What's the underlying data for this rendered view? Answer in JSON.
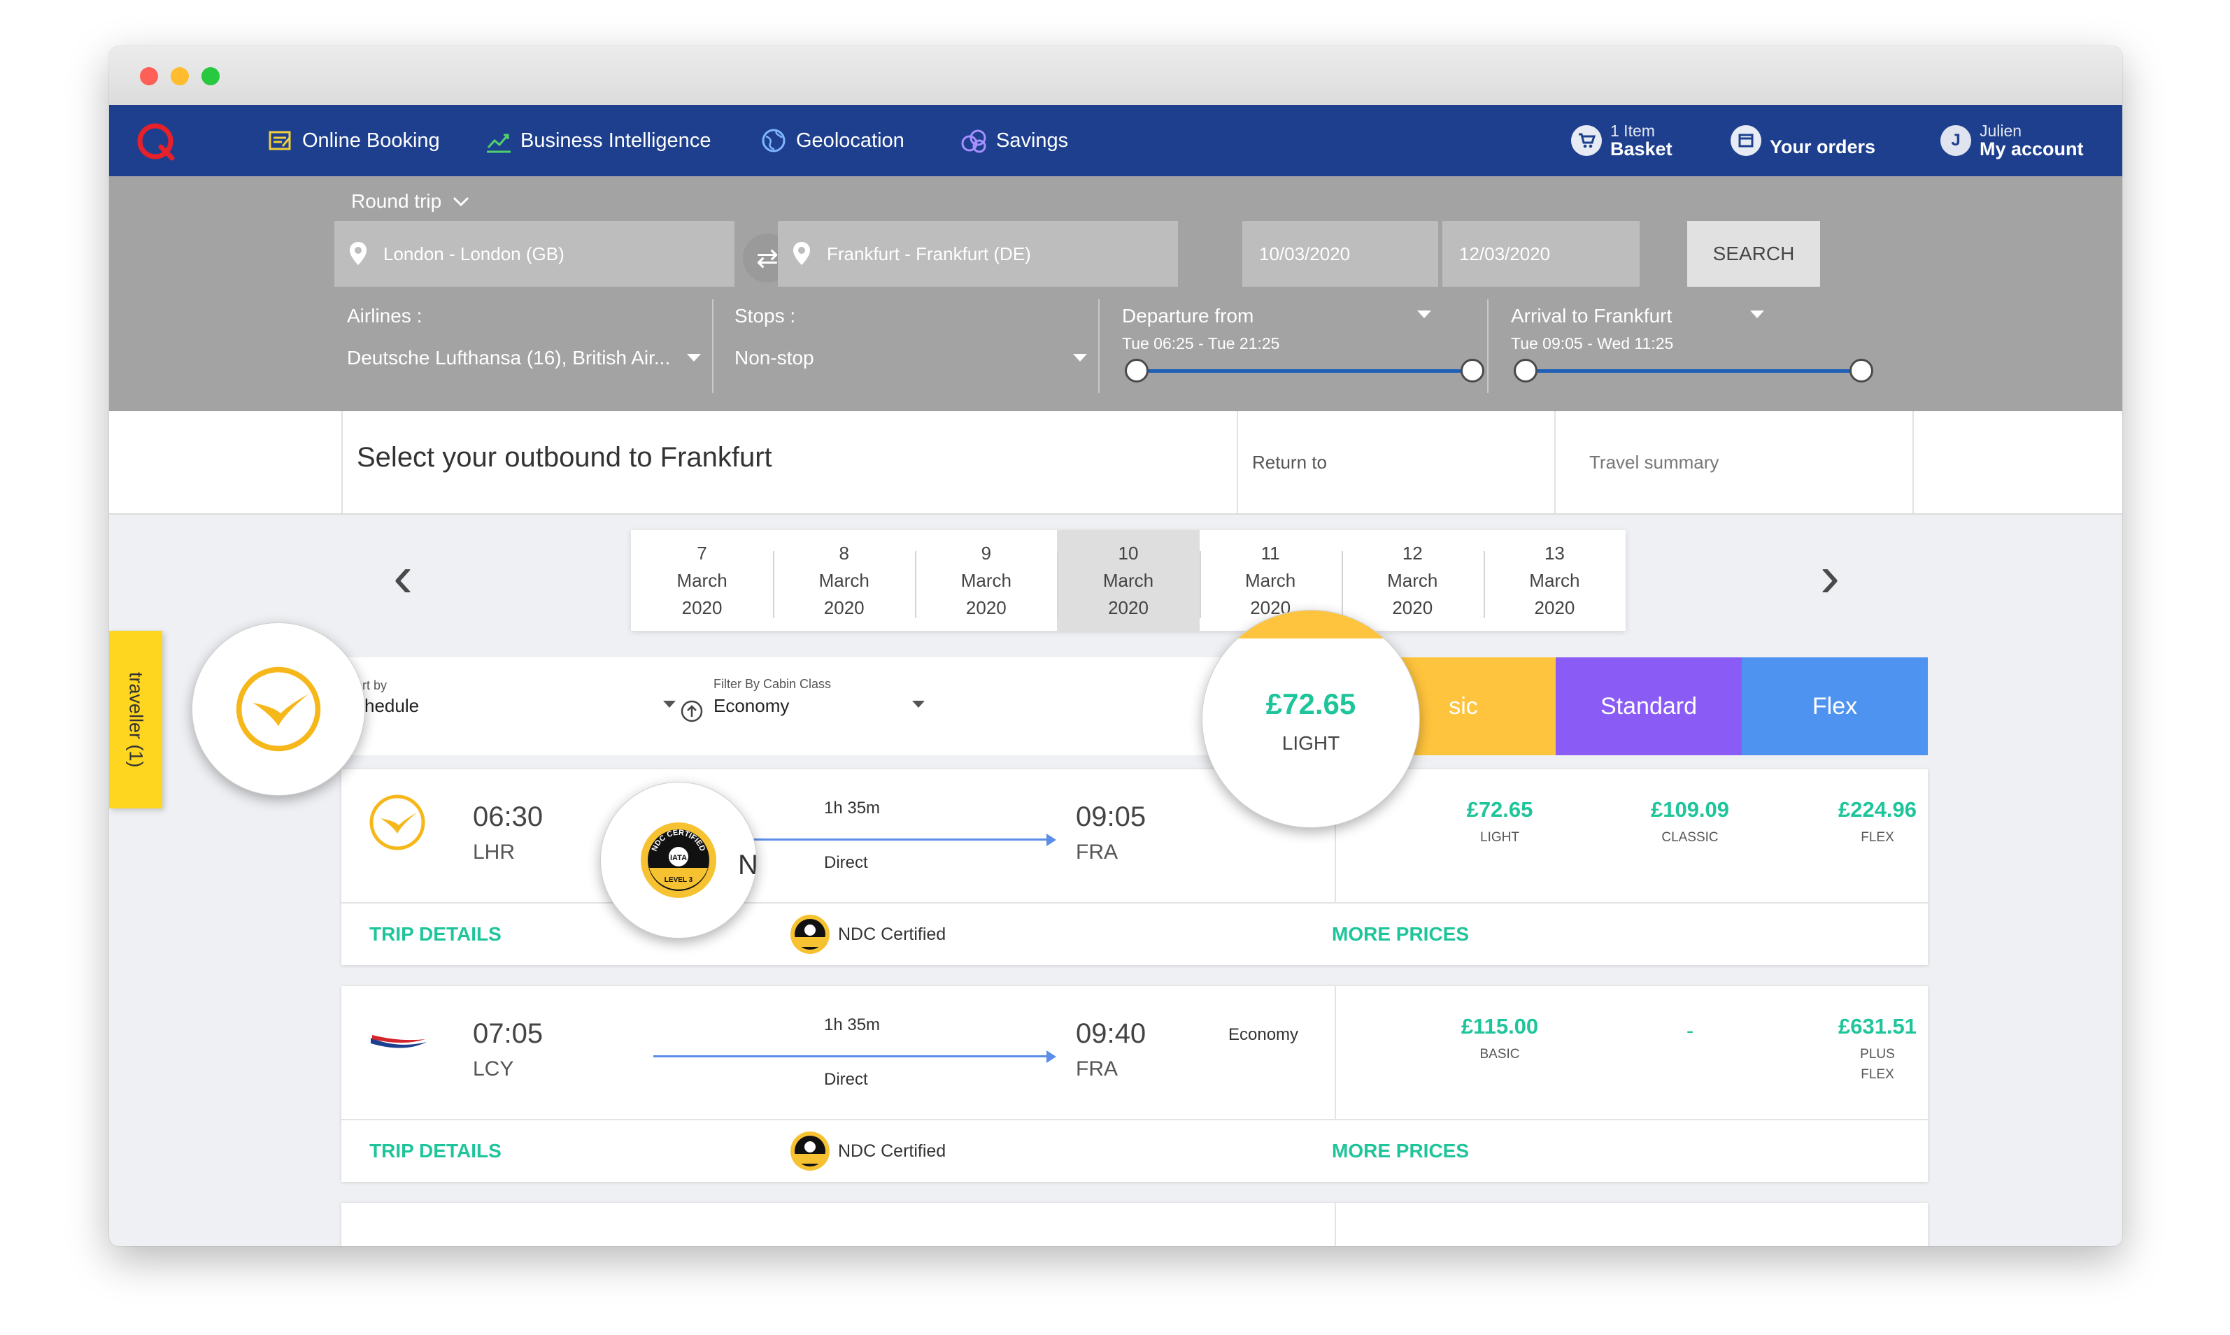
{
  "nav": {
    "items": [
      {
        "label": "Online Booking"
      },
      {
        "label": "Business Intelligence"
      },
      {
        "label": "Geolocation"
      },
      {
        "label": "Savings"
      }
    ],
    "basket": {
      "count": "1 Item",
      "label": "Basket"
    },
    "orders": {
      "label": "Your orders"
    },
    "account": {
      "user": "Julien",
      "label": "My account",
      "initial": "J"
    }
  },
  "search": {
    "trip_type": "Round trip",
    "origin": "London - London (GB)",
    "destination": "Frankfurt - Frankfurt (DE)",
    "depart_date": "10/03/2020",
    "return_date": "12/03/2020",
    "search_button": "SEARCH",
    "airlines_label": "Airlines :",
    "airlines_value": "Deutsche Lufthansa (16), British Air...",
    "stops_label": "Stops :",
    "stops_value": "Non-stop",
    "departure_label": "Departure from",
    "departure_range": "Tue 06:25 - Tue 21:25",
    "arrival_label": "Arrival to Frankfurt",
    "arrival_range": "Tue 09:05 - Wed 11:25"
  },
  "header": {
    "title": "Select your outbound to Frankfurt",
    "return_to": "Return to",
    "travel_summary": "Travel summary"
  },
  "dates": [
    {
      "day": "7",
      "month": "March",
      "year": "2020"
    },
    {
      "day": "8",
      "month": "March",
      "year": "2020"
    },
    {
      "day": "9",
      "month": "March",
      "year": "2020"
    },
    {
      "day": "10",
      "month": "March",
      "year": "2020"
    },
    {
      "day": "11",
      "month": "March",
      "year": "2020"
    },
    {
      "day": "12",
      "month": "March",
      "year": "2020"
    },
    {
      "day": "13",
      "month": "March",
      "year": "2020"
    }
  ],
  "traveller_tab": "traveller (1)",
  "filters": {
    "sort_label": "ort by",
    "sort_value": "chedule",
    "cabin_label": "Filter By Cabin Class",
    "cabin_value": "Economy"
  },
  "fare_tabs": [
    "sic",
    "Standard",
    "Flex"
  ],
  "fare_tab_colors": {
    "basic": "#ffc43d",
    "standard": "#8a5cf5",
    "flex": "#4f93f1"
  },
  "magnifier": {
    "price": "£72.65",
    "fare": "LIGHT"
  },
  "flights": [
    {
      "depart_time": "06:30",
      "depart_airport": "LHR",
      "arrive_time": "09:05",
      "arrive_airport": "FRA",
      "duration": "1h 35m",
      "stops": "Direct",
      "stamp_letter": "N",
      "prices": [
        {
          "amount": "£72.65",
          "fare": "LIGHT"
        },
        {
          "amount": "£109.09",
          "fare": "CLASSIC"
        },
        {
          "amount": "£224.96",
          "fare": "FLEX"
        }
      ],
      "trip_details": "TRIP DETAILS",
      "ndc": "NDC Certified",
      "more_prices": "MORE PRICES"
    },
    {
      "depart_time": "07:05",
      "depart_airport": "LCY",
      "arrive_time": "09:40",
      "arrive_airport": "FRA",
      "duration": "1h 35m",
      "stops": "Direct",
      "cabin": "Economy",
      "prices": [
        {
          "amount": "£115.00",
          "fare": "BASIC"
        },
        {
          "amount": "-",
          "fare": ""
        },
        {
          "amount": "£631.51",
          "fare": "PLUS\nFLEX"
        }
      ],
      "trip_details": "TRIP DETAILS",
      "ndc": "NDC Certified",
      "more_prices": "MORE PRICES"
    }
  ],
  "stamp": {
    "top_text": "NDC CERTIFIED",
    "center_text": "IATA",
    "level_text": "LEVEL 3"
  },
  "icons": [
    "logo-icon",
    "booking-icon",
    "chart-icon",
    "globe-icon",
    "savings-icon",
    "cart-icon",
    "orders-icon",
    "avatar-icon",
    "pin-icon",
    "swap-icon",
    "chevron-left-icon",
    "chevron-right-icon",
    "crane-icon",
    "ndc-badge-icon",
    "sort-icon"
  ]
}
